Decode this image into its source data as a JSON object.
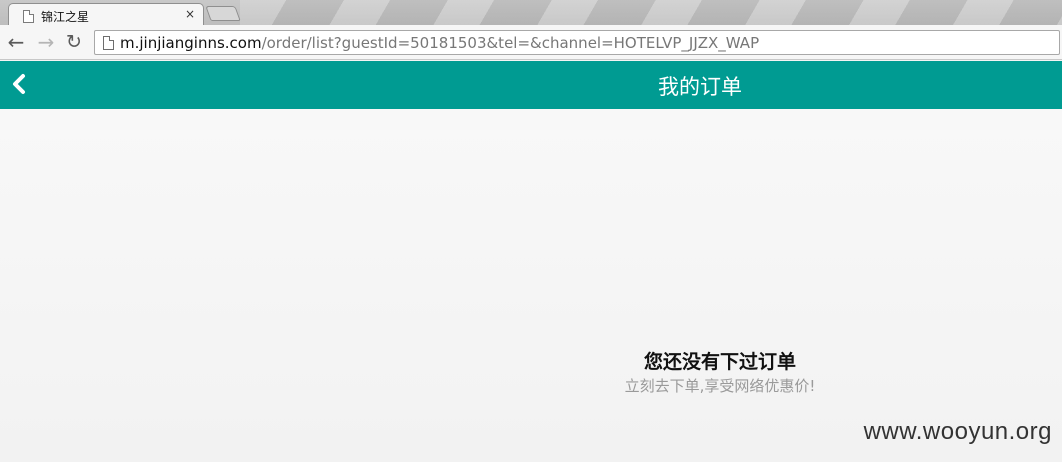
{
  "browser": {
    "tab": {
      "title": "锦江之星",
      "close_glyph": "×"
    },
    "toolbar": {
      "back_glyph": "←",
      "forward_glyph": "→",
      "reload_glyph": "↻",
      "url_host": "m.jinjianginns.com",
      "url_path": "/order/list?guestId=50181503&tel=&channel=HOTELVP_JJZX_WAP"
    }
  },
  "app": {
    "header": {
      "title": "我的订单",
      "background": "#009b92",
      "back_icon": "chevron-left-icon"
    },
    "empty_state": {
      "title": "您还没有下过订单",
      "subtitle": "立刻去下单,享受网络优惠价!"
    }
  },
  "watermark": "www.wooyun.org"
}
